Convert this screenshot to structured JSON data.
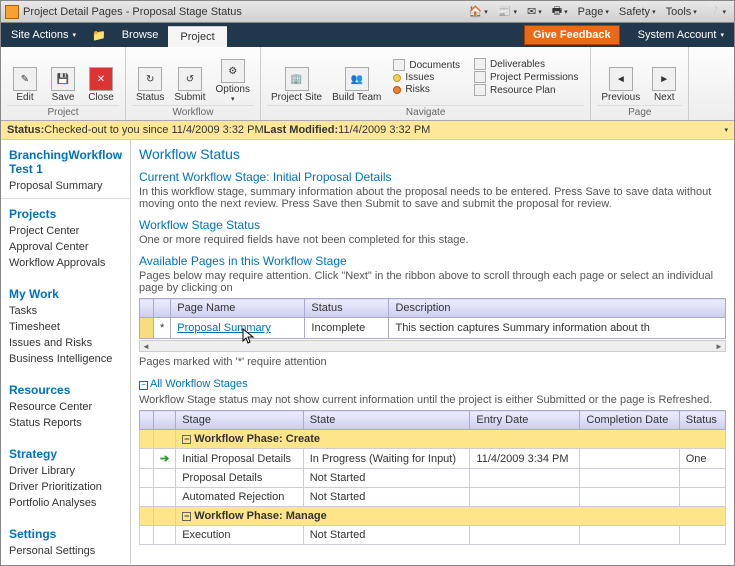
{
  "title": "Project Detail Pages - Proposal Stage Status",
  "ie_menu": [
    "Page",
    "Safety",
    "Tools"
  ],
  "darkbar": {
    "site_actions": "Site Actions",
    "browse": "Browse",
    "project": "Project",
    "feedback": "Give Feedback",
    "account": "System Account"
  },
  "ribbon": {
    "edit": "Edit",
    "save": "Save",
    "close": "Close",
    "status": "Status",
    "submit": "Submit",
    "options": "Options",
    "project_site": "Project Site",
    "build_team": "Build Team",
    "documents": "Documents",
    "issues": "Issues",
    "risks": "Risks",
    "deliverables": "Deliverables",
    "project_permissions": "Project Permissions",
    "resource_plan": "Resource Plan",
    "previous": "Previous",
    "next": "Next",
    "group_project": "Project",
    "group_workflow": "Workflow",
    "group_navigate": "Navigate",
    "group_page": "Page"
  },
  "status_bar": {
    "prefix": "Status:",
    "text": " Checked-out to you since 11/4/2009 3:32 PM ",
    "lm_label": "Last Modified:",
    "lm_value": " 11/4/2009 3:32 PM"
  },
  "sidebar": {
    "title": "BranchingWorkflow Test 1",
    "summary": "Proposal Summary",
    "projects": "Projects",
    "projects_items": [
      "Project Center",
      "Approval Center",
      "Workflow Approvals"
    ],
    "mywork": "My Work",
    "mywork_items": [
      "Tasks",
      "Timesheet",
      "Issues and Risks",
      "Business Intelligence"
    ],
    "resources": "Resources",
    "resources_items": [
      "Resource Center",
      "Status Reports"
    ],
    "strategy": "Strategy",
    "strategy_items": [
      "Driver Library",
      "Driver Prioritization",
      "Portfolio Analyses"
    ],
    "settings": "Settings",
    "settings_items": [
      "Personal Settings"
    ]
  },
  "content": {
    "h2": "Workflow Status",
    "stage_h": "Current Workflow Stage: Initial Proposal Details",
    "stage_p": "In this workflow stage, summary information about the proposal needs to be entered. Press Save to save data without moving onto the next review. Press Save then Submit to save and submit the proposal for review.",
    "wss_h": "Workflow Stage Status",
    "wss_p": "One or more required fields have not been completed for this stage.",
    "avail_h": "Available Pages in this Workflow Stage",
    "avail_p": "Pages below may require attention. Click \"Next\" in the ribbon above to scroll through each page or select an individual page by clicking on",
    "t1_headers": [
      "Page Name",
      "Status",
      "Description"
    ],
    "t1_row": {
      "star": "*",
      "page": "Proposal Summary",
      "status": "Incomplete",
      "desc": "This section captures Summary information about th"
    },
    "t1_note": "Pages marked with '*' require attention",
    "all_stages": "All Workflow Stages",
    "stages_p": "Workflow Stage status may not show current information until the project is either Submitted or the page is Refreshed.",
    "t2_headers": [
      "Stage",
      "State",
      "Entry Date",
      "Completion Date",
      "Status"
    ],
    "phase_create": "Workflow Phase: Create",
    "phase_manage": "Workflow Phase: Manage",
    "rows": [
      {
        "stage": "Initial Proposal Details",
        "state": "In Progress (Waiting for Input)",
        "entry": "11/4/2009 3:34 PM",
        "completion": "",
        "status": "One"
      },
      {
        "stage": "Proposal Details",
        "state": "Not Started",
        "entry": "",
        "completion": "",
        "status": ""
      },
      {
        "stage": "Automated Rejection",
        "state": "Not Started",
        "entry": "",
        "completion": "",
        "status": ""
      },
      {
        "stage": "Execution",
        "state": "Not Started",
        "entry": "",
        "completion": "",
        "status": ""
      }
    ]
  }
}
